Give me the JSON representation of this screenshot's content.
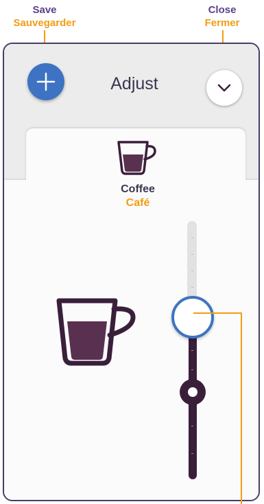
{
  "callouts": {
    "save": {
      "en": "Save",
      "fr": "Sauvegarder"
    },
    "close": {
      "en": "Close",
      "fr": "Fermer"
    }
  },
  "header": {
    "title": "Adjust",
    "add_icon": "plus-icon",
    "close_icon": "chevron-down-icon"
  },
  "drink": {
    "name_en": "Coffee",
    "name_fr": "Café",
    "icon": "coffee-cup-icon"
  },
  "volume_slider": {
    "level": 0.62,
    "default_level": 0.3
  },
  "colors": {
    "accent_blue": "#3d73c2",
    "callout_orange": "#f39c12",
    "callout_purple": "#5a3f8c",
    "dark_plum": "#3a1f3b"
  }
}
